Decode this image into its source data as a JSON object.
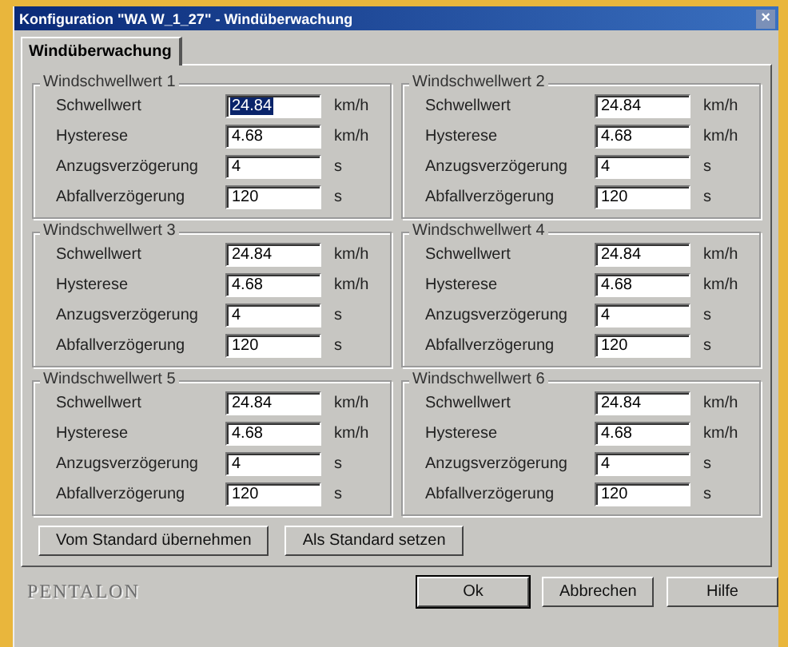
{
  "window": {
    "title": "Konfiguration \"WA W_1_27\" - Windüberwachung",
    "close": "×"
  },
  "tabs": [
    {
      "label": "Windüberwachung",
      "selected": true
    }
  ],
  "groups": [
    {
      "title": "Windschwellwert 1",
      "rows": [
        {
          "label": "Schwellwert",
          "value": "24.84",
          "unit": "km/h",
          "highlighted": true
        },
        {
          "label": "Hysterese",
          "value": "4.68",
          "unit": "km/h",
          "highlighted": false
        },
        {
          "label": "Anzugsverzögerung",
          "value": "4",
          "unit": "s",
          "highlighted": false
        },
        {
          "label": "Abfallverzögerung",
          "value": "120",
          "unit": "s",
          "highlighted": false
        }
      ]
    },
    {
      "title": "Windschwellwert 2",
      "rows": [
        {
          "label": "Schwellwert",
          "value": "24.84",
          "unit": "km/h",
          "highlighted": false
        },
        {
          "label": "Hysterese",
          "value": "4.68",
          "unit": "km/h",
          "highlighted": false
        },
        {
          "label": "Anzugsverzögerung",
          "value": "4",
          "unit": "s",
          "highlighted": false
        },
        {
          "label": "Abfallverzögerung",
          "value": "120",
          "unit": "s",
          "highlighted": false
        }
      ]
    },
    {
      "title": "Windschwellwert 3",
      "rows": [
        {
          "label": "Schwellwert",
          "value": "24.84",
          "unit": "km/h",
          "highlighted": false
        },
        {
          "label": "Hysterese",
          "value": "4.68",
          "unit": "km/h",
          "highlighted": false
        },
        {
          "label": "Anzugsverzögerung",
          "value": "4",
          "unit": "s",
          "highlighted": false
        },
        {
          "label": "Abfallverzögerung",
          "value": "120",
          "unit": "s",
          "highlighted": false
        }
      ]
    },
    {
      "title": "Windschwellwert 4",
      "rows": [
        {
          "label": "Schwellwert",
          "value": "24.84",
          "unit": "km/h",
          "highlighted": false
        },
        {
          "label": "Hysterese",
          "value": "4.68",
          "unit": "km/h",
          "highlighted": false
        },
        {
          "label": "Anzugsverzögerung",
          "value": "4",
          "unit": "s",
          "highlighted": false
        },
        {
          "label": "Abfallverzögerung",
          "value": "120",
          "unit": "s",
          "highlighted": false
        }
      ]
    },
    {
      "title": "Windschwellwert 5",
      "rows": [
        {
          "label": "Schwellwert",
          "value": "24.84",
          "unit": "km/h",
          "highlighted": false
        },
        {
          "label": "Hysterese",
          "value": "4.68",
          "unit": "km/h",
          "highlighted": false
        },
        {
          "label": "Anzugsverzögerung",
          "value": "4",
          "unit": "s",
          "highlighted": false
        },
        {
          "label": "Abfallverzögerung",
          "value": "120",
          "unit": "s",
          "highlighted": false
        }
      ]
    },
    {
      "title": "Windschwellwert 6",
      "rows": [
        {
          "label": "Schwellwert",
          "value": "24.84",
          "unit": "km/h",
          "highlighted": false
        },
        {
          "label": "Hysterese",
          "value": "4.68",
          "unit": "km/h",
          "highlighted": false
        },
        {
          "label": "Anzugsverzögerung",
          "value": "4",
          "unit": "s",
          "highlighted": false
        },
        {
          "label": "Abfallverzögerung",
          "value": "120",
          "unit": "s",
          "highlighted": false
        }
      ]
    }
  ],
  "panel_buttons": [
    "Vom Standard übernehmen",
    "Als Standard setzen"
  ],
  "logo": "PENTALON",
  "dialog_buttons": [
    {
      "label": "Ok",
      "default": true
    },
    {
      "label": "Abbrechen",
      "default": false
    },
    {
      "label": "Hilfe",
      "default": false
    }
  ]
}
